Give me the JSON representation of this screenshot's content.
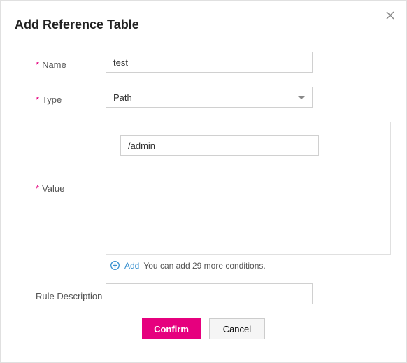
{
  "dialog": {
    "title": "Add Reference Table",
    "close": "Close"
  },
  "form": {
    "name": {
      "label": "Name",
      "value": "test"
    },
    "type": {
      "label": "Type",
      "selected": "Path"
    },
    "value": {
      "label": "Value",
      "items": [
        {
          "value": "/admin"
        }
      ],
      "add_label": "Add",
      "add_hint": "You can add 29 more conditions."
    },
    "description": {
      "label": "Rule Description",
      "value": ""
    }
  },
  "buttons": {
    "confirm": "Confirm",
    "cancel": "Cancel"
  }
}
